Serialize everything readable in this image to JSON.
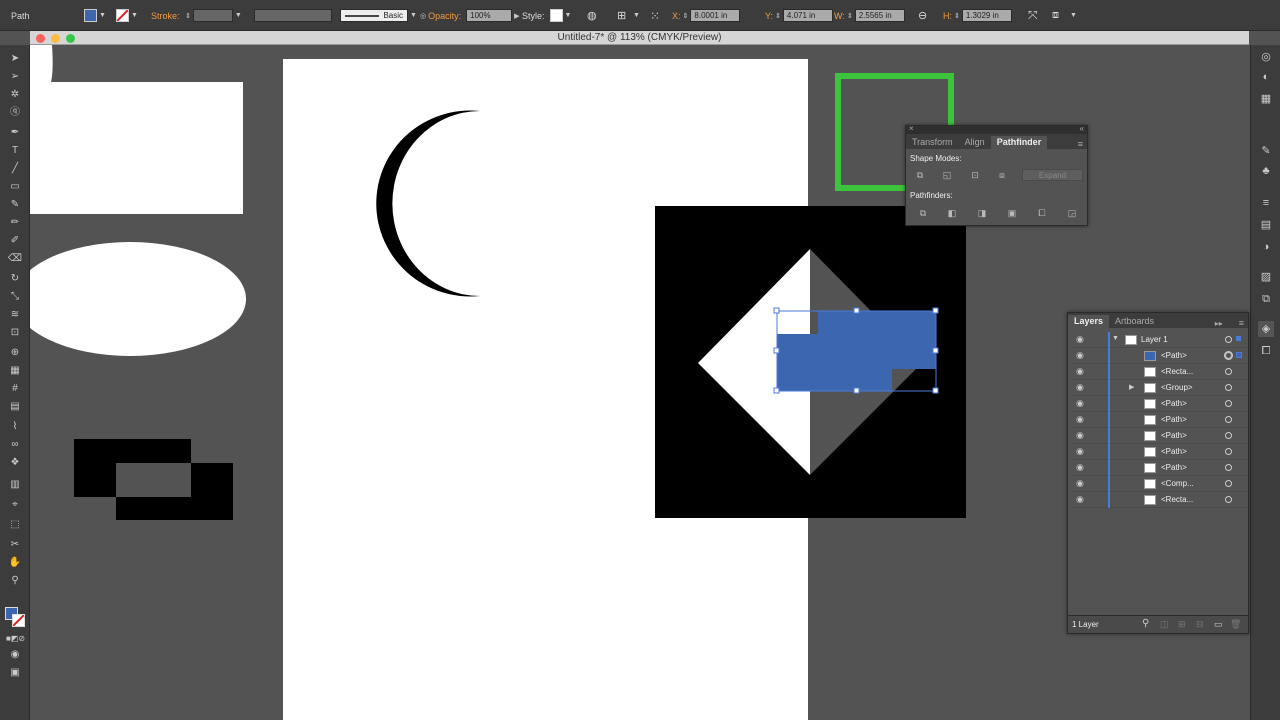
{
  "control_bar": {
    "selection_type": "Path",
    "stroke_label": "Stroke:",
    "brush_label": "Basic",
    "opacity_label": "Opacity:",
    "opacity_value": "100%",
    "style_label": "Style:",
    "x_label": "X:",
    "x_value": "8.0001 in",
    "y_label": "Y:",
    "y_value": "4.071 in",
    "w_label": "W:",
    "w_value": "2.5565 in",
    "h_label": "H:",
    "h_value": "1.3029 in",
    "fill_color": "#3d66b0"
  },
  "window": {
    "title": "Untitled-7* @ 113% (CMYK/Preview)"
  },
  "pathfinder_panel": {
    "tabs": [
      "Transform",
      "Align",
      "Pathfinder"
    ],
    "active_tab": "Pathfinder",
    "shape_modes_label": "Shape Modes:",
    "expand_label": "Expand",
    "pathfinders_label": "Pathfinders:"
  },
  "layers_panel": {
    "tabs": [
      "Layers",
      "Artboards"
    ],
    "active_tab": "Layers",
    "layer_name": "Layer 1",
    "items": [
      "<Path>",
      "<Recta...",
      "<Group>",
      "<Path>",
      "<Path>",
      "<Path>",
      "<Path>",
      "<Path>",
      "<Comp...",
      "<Recta..."
    ],
    "footer_count": "1 Layer"
  },
  "colors": {
    "selection_blue": "#3d66b0",
    "green_frame": "#3dc43d",
    "ui_dark": "#3c3c3c",
    "pasteboard": "#535353"
  }
}
